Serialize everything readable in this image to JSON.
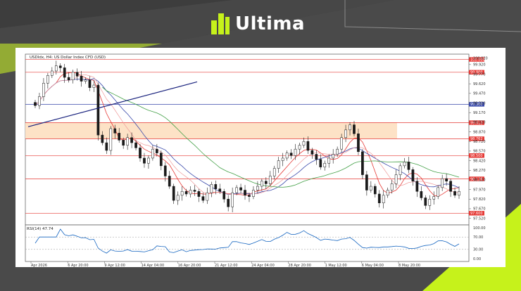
{
  "brand": {
    "name": "Ultima",
    "accent": "#c6f21b"
  },
  "chart_data": {
    "type": "candlestick",
    "title": "USDIdx, H4: US Dollar Index CFD (USD)",
    "y_ticks": [
      "100.020",
      "99.920",
      "99.770",
      "99.620",
      "99.470",
      "99.320",
      "99.170",
      "99.020",
      "98.870",
      "98.720",
      "98.570",
      "98.420",
      "98.270",
      "98.120",
      "97.970",
      "97.820",
      "97.670",
      "97.520"
    ],
    "ylim": [
      97.45,
      100.05
    ],
    "x_labels": [
      "Apr 2026",
      "6 Apr 20:00",
      "9 Apr 12:00",
      "14 Apr 04:00",
      "16 Apr 20:00",
      "21 Apr 12:00",
      "24 Apr 04:00",
      "28 Apr 20:00",
      "1 May 12:00",
      "6 May 04:00",
      "8 May 20:00"
    ],
    "price_levels": [
      {
        "label": "100.000",
        "value": 100.0,
        "color": "#e53935"
      },
      {
        "label": "99.800",
        "value": 99.8,
        "color": "#e53935"
      },
      {
        "label": "99.300",
        "value": 99.3,
        "color": "#3949ab"
      },
      {
        "label": "99.013",
        "value": 99.013,
        "color": "#e53935"
      },
      {
        "label": "98.762",
        "value": 98.762,
        "color": "#e53935"
      },
      {
        "label": "98.500",
        "value": 98.5,
        "color": "#e53935"
      },
      {
        "label": "98.136",
        "value": 98.136,
        "color": "#e53935"
      },
      {
        "label": "97.600",
        "value": 97.6,
        "color": "#e53935"
      }
    ],
    "zone": {
      "from": 98.762,
      "to": 99.013,
      "color": "#fde2c6"
    },
    "trendline": {
      "x": [
        0,
        76
      ],
      "y": [
        98.95,
        99.65
      ],
      "color": "#1a237e"
    },
    "closes": [
      99.28,
      99.42,
      99.63,
      99.75,
      99.82,
      99.9,
      99.87,
      99.72,
      99.68,
      99.8,
      99.74,
      99.66,
      99.68,
      99.56,
      99.6,
      98.82,
      98.7,
      98.58,
      98.92,
      98.85,
      98.74,
      98.66,
      98.78,
      98.7,
      98.62,
      98.46,
      98.38,
      98.46,
      98.6,
      98.54,
      98.34,
      98.18,
      98.02,
      97.8,
      97.88,
      97.94,
      97.9,
      97.96,
      97.94,
      97.86,
      97.8,
      97.92,
      98.05,
      97.98,
      97.94,
      97.82,
      97.7,
      97.92,
      98.0,
      97.96,
      97.88,
      97.86,
      97.96,
      98.02,
      98.1,
      98.06,
      98.18,
      98.3,
      98.42,
      98.46,
      98.54,
      98.5,
      98.6,
      98.66,
      98.72,
      98.58,
      98.52,
      98.44,
      98.32,
      98.38,
      98.46,
      98.52,
      98.6,
      98.78,
      98.9,
      98.98,
      98.84,
      98.56,
      98.2,
      97.96,
      98.02,
      97.9,
      97.76,
      97.88,
      97.96,
      98.06,
      98.2,
      98.34,
      98.4,
      98.28,
      98.1,
      97.94,
      97.84,
      97.72,
      97.82,
      97.86,
      98.0,
      98.14,
      98.1,
      97.94,
      97.88,
      97.94
    ],
    "indicator": {
      "label": "RSI(14) 47.74",
      "ticks": [
        "100.00",
        "70.00",
        "30.00",
        "0.00"
      ],
      "ylim": [
        0,
        100
      ],
      "levels": [
        70,
        30
      ],
      "value": 47.74
    },
    "colors": {
      "up": "#1a1a1a",
      "down": "#1a1a1a",
      "ma_fast": "#e53935",
      "ma_mid": "#3949ab",
      "ma_slow": "#43a047",
      "rsi": "#1565c0",
      "ma_faint": "#ef9a9a"
    }
  }
}
